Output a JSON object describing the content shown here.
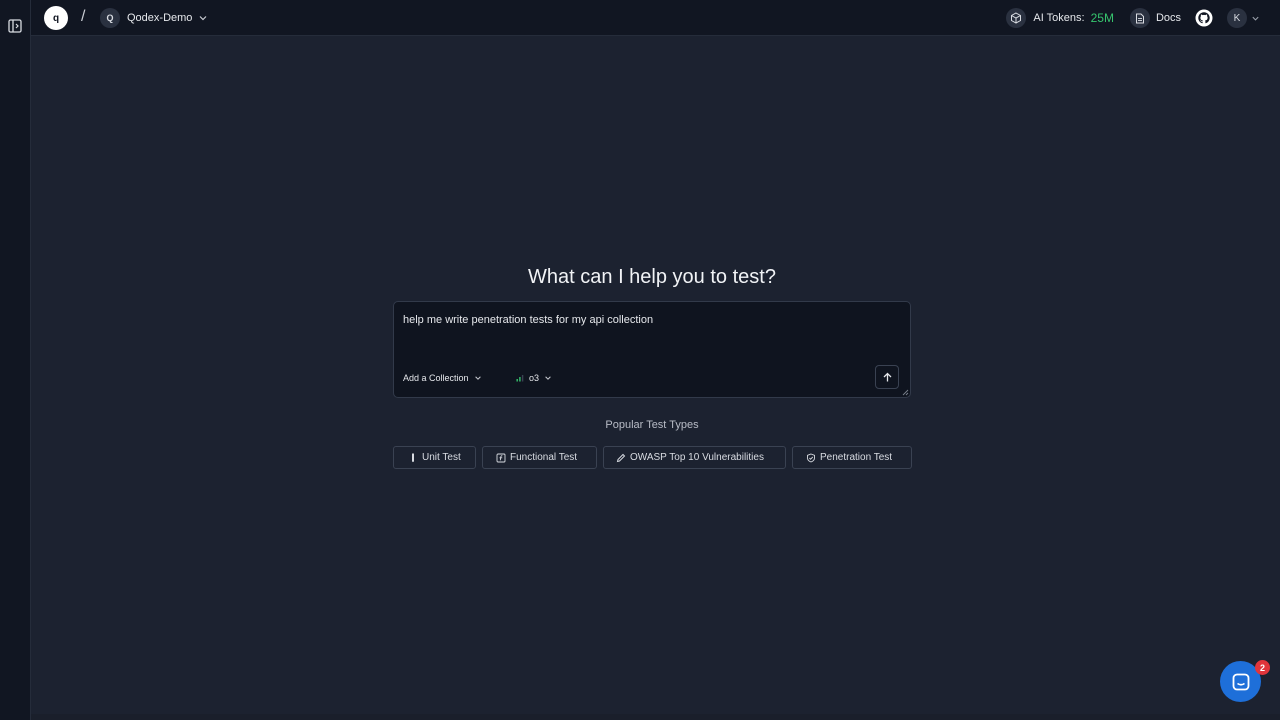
{
  "header": {
    "logo_letter": "q",
    "separator": "/",
    "workspace": {
      "avatar_letter": "Q",
      "name": "Qodex-Demo"
    },
    "ai_tokens": {
      "label": "AI Tokens:",
      "value": "25M"
    },
    "docs_label": "Docs",
    "user_initial": "K"
  },
  "main": {
    "headline": "What can I help you to test?",
    "prompt": {
      "text": "help me write penetration tests for my api collection",
      "collection_label": "Add a Collection",
      "model_label": "o3"
    },
    "popular_title": "Popular Test Types",
    "chips": [
      {
        "label": "Unit Test",
        "icon": "flask-icon"
      },
      {
        "label": "Functional Test",
        "icon": "function-icon"
      },
      {
        "label": "OWASP Top 10 Vulnerabilities",
        "icon": "pen-icon"
      },
      {
        "label": "Penetration Test",
        "icon": "shield-check-icon"
      }
    ]
  },
  "chat": {
    "badge_count": "2"
  },
  "colors": {
    "background": "#1c2230",
    "topbar": "#111622",
    "tokens_value": "#36c46e",
    "chat_launcher": "#1e6fd9",
    "badge": "#e0353b"
  }
}
